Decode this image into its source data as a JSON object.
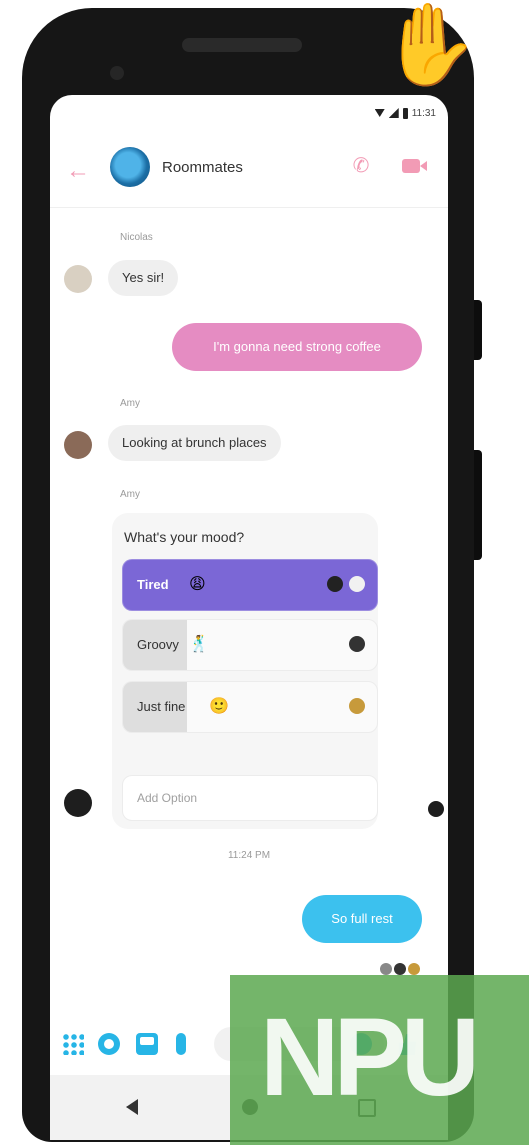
{
  "header": {
    "group_name": "Roommates",
    "back_icon": "arrow-left-icon",
    "call_icon": "phone-icon",
    "video_icon": "video-camera-icon",
    "accent_color": "#f29bb5"
  },
  "status_bar": {
    "time": "11:31"
  },
  "messages": [
    {
      "sender": "Nicolas",
      "text": "Yes sir!",
      "direction": "incoming"
    },
    {
      "text": "I'm gonna need strong coffee",
      "direction": "outgoing",
      "color": "#e58cc2"
    },
    {
      "sender": "Amy",
      "text": "Looking at brunch places",
      "direction": "incoming"
    },
    {
      "sender": "Amy",
      "direction": "incoming",
      "type": "poll"
    }
  ],
  "poll": {
    "question": "What's your mood?",
    "options": [
      {
        "label": "Tired",
        "emoji": "😩",
        "share": 1.0,
        "selected": true
      },
      {
        "label": "Groovy",
        "emoji": "🕺",
        "share": 0.25,
        "selected": false
      },
      {
        "label": "Just fine",
        "emoji": "🙂",
        "share": 0.25,
        "selected": false
      }
    ],
    "add_option_placeholder": "Add Option",
    "selected_color": "#7b67d6"
  },
  "timestamp": "11:24 PM",
  "last_message": {
    "text": "So full rest",
    "direction": "outgoing",
    "color": "#3cc1ee"
  },
  "composer": {
    "icons": [
      "grid-dots-icon",
      "camera-icon",
      "photo-icon",
      "mic-icon",
      "emoji-icon",
      "thumbs-up-icon"
    ],
    "accent_color": "#27b5e6"
  },
  "nav_bar": {
    "icons": [
      "back-triangle-icon",
      "home-circle-icon",
      "recents-square-icon"
    ]
  },
  "overlay": {
    "hand_emoji": "✋",
    "watermark": "NPU"
  }
}
